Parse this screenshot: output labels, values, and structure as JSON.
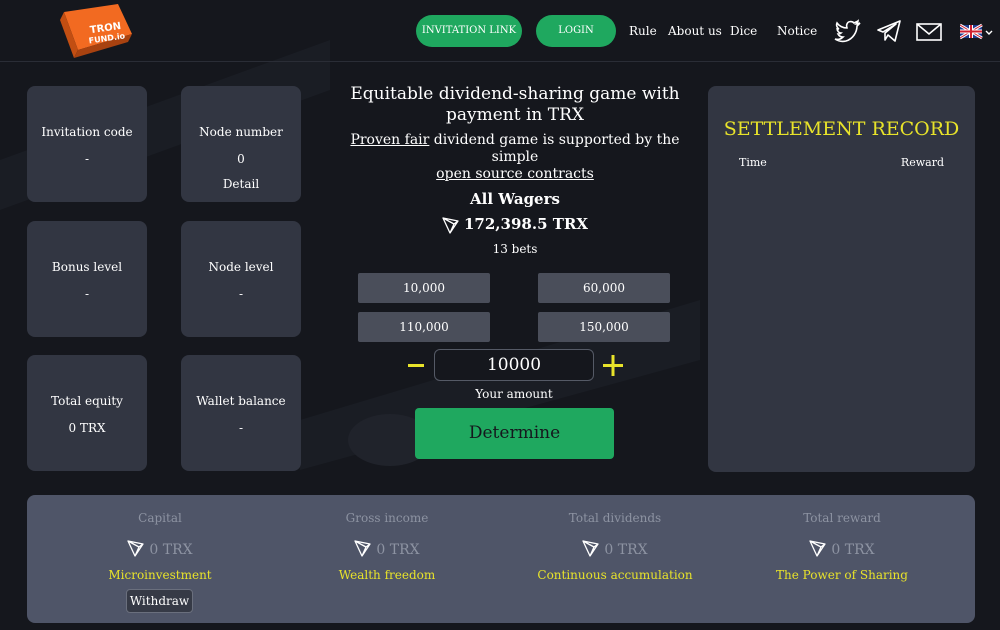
{
  "brand": {
    "logo_line1": "TRON",
    "logo_line2": "FUND.io"
  },
  "header": {
    "invitation_link": "INVITATION LINK",
    "login": "LOGIN",
    "nav": [
      "Rule",
      "About us",
      "Dice",
      "Notice"
    ],
    "icons": [
      "twitter-icon",
      "telegram-icon",
      "mail-icon",
      "uk-flag-icon"
    ]
  },
  "cards": {
    "invitation_code": {
      "label": "Invitation code",
      "value": "-"
    },
    "node_number": {
      "label": "Node number",
      "value": "0",
      "link": "Detail"
    },
    "bonus_level": {
      "label": "Bonus level",
      "value": "-"
    },
    "node_level": {
      "label": "Node level",
      "value": "-"
    },
    "total_equity": {
      "label": "Total equity",
      "value": "0 TRX"
    },
    "wallet_balance": {
      "label": "Wallet balance",
      "value": "-"
    }
  },
  "game": {
    "title_line1": "Equitable dividend-sharing game with",
    "title_line2": "payment in TRX",
    "proven_fair": "Proven fair",
    "sub_text": " dividend game is supported by the simple",
    "open_source": "open source contracts",
    "wagers_label": "All Wagers",
    "wagers_value": "172,398.5 TRX",
    "bets": "13 bets",
    "presets": [
      "10,000",
      "60,000",
      "110,000",
      "150,000"
    ],
    "amount": "10000",
    "amount_label": "Your amount",
    "determine": "Determine"
  },
  "settlement": {
    "title": "SETTLEMENT RECORD",
    "col_time": "Time",
    "col_reward": "Reward"
  },
  "stats": [
    {
      "label": "Capital",
      "value": "0 TRX",
      "slogan": "Microinvestment"
    },
    {
      "label": "Gross income",
      "value": "0 TRX",
      "slogan": "Wealth freedom"
    },
    {
      "label": "Total dividends",
      "value": "0 TRX",
      "slogan": "Continuous accumulation"
    },
    {
      "label": "Total reward",
      "value": "0 TRX",
      "slogan": "The Power of Sharing"
    }
  ],
  "withdraw": "Withdraw",
  "colors": {
    "accent_green": "#1fa85f",
    "highlight_yellow": "#e8e32a",
    "card_bg": "#323642",
    "page_bg": "#15171d"
  }
}
